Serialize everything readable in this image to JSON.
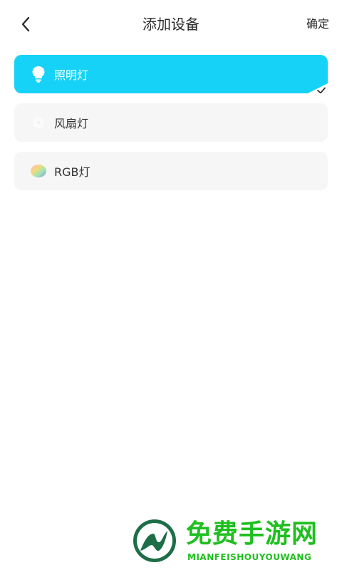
{
  "header": {
    "title": "添加设备",
    "confirm_label": "确定",
    "back_icon": "chevron-left-icon"
  },
  "devices": [
    {
      "label": "照明灯",
      "icon": "light-bulb-icon",
      "selected": true
    },
    {
      "label": "风扇灯",
      "icon": "fan-icon",
      "selected": false
    },
    {
      "label": "RGB灯",
      "icon": "rgb-color-icon",
      "selected": false
    }
  ],
  "colors": {
    "accent": "#17d2f7",
    "card_bg": "#f6f6f6",
    "watermark_green": "#1fbf1f"
  },
  "watermark": {
    "title": "免费手游网",
    "subtitle": "MIANFEISHOUYOUWANG"
  }
}
